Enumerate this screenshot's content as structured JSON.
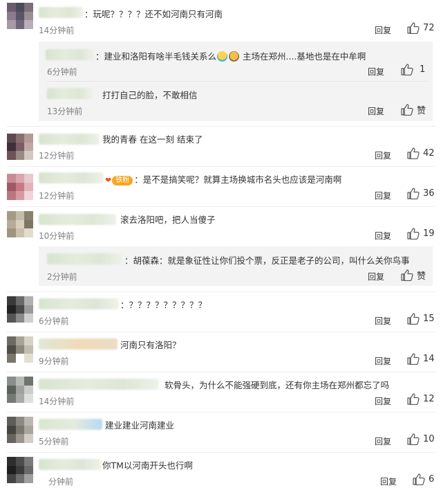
{
  "labels": {
    "reply": "回复"
  },
  "comments": [
    {
      "text": "：玩呢？？？？还不如河南只有河南",
      "time": "14分钟前",
      "likes": "72"
    },
    {
      "text": "：建业和洛阳有啥半毛钱关系么",
      "text_after_emoji": "主场在郑州....基地也是在中牟啊",
      "time": "6分钟前",
      "likes": "1"
    },
    {
      "text": "打打自己的脸，不敢相信",
      "time": "13分钟前",
      "likes": "赞"
    },
    {
      "text": "我的青春 在这一刻 结束了",
      "time": "12分钟前",
      "likes": "42"
    },
    {
      "badge": "铁粉",
      "text": "：是不是搞笑呢？就算主场换城市名头也应该是河南啊",
      "time": "12分钟前",
      "likes": "36"
    },
    {
      "text": "滚去洛阳吧，把人当傻子",
      "time": "10分钟前",
      "likes": "19"
    },
    {
      "text": "：胡葆森：就是象征性让你们投个票，反正是老子的公司，叫什么关你鸟事",
      "time": "2分钟前",
      "likes": "赞"
    },
    {
      "text": "：？？？？？？？？？",
      "time": "6分钟前",
      "likes": "15"
    },
    {
      "text": "河南只有洛阳？",
      "time": "9分钟前",
      "likes": "14"
    },
    {
      "text": "软骨头，为什么不能强硬到底，还有你主场在郑州都忘了吗",
      "time": "14分钟前",
      "likes": "12"
    },
    {
      "text": "建业建业河南建业",
      "time": "5分钟前",
      "likes": "10"
    },
    {
      "text": "你TM以河南开头也行啊",
      "time": "分钟前",
      "likes": "6"
    }
  ],
  "icons": {
    "thumb": "thumbs-up-icon",
    "emoji_a": "doge-emoji-icon",
    "emoji_b": "monkey-emoji-icon",
    "heart": "heart-icon"
  },
  "colors": {
    "background": "#ffffff",
    "reply_bg": "#f3f3f3",
    "time": "#808080",
    "badge": "#f6a623"
  }
}
